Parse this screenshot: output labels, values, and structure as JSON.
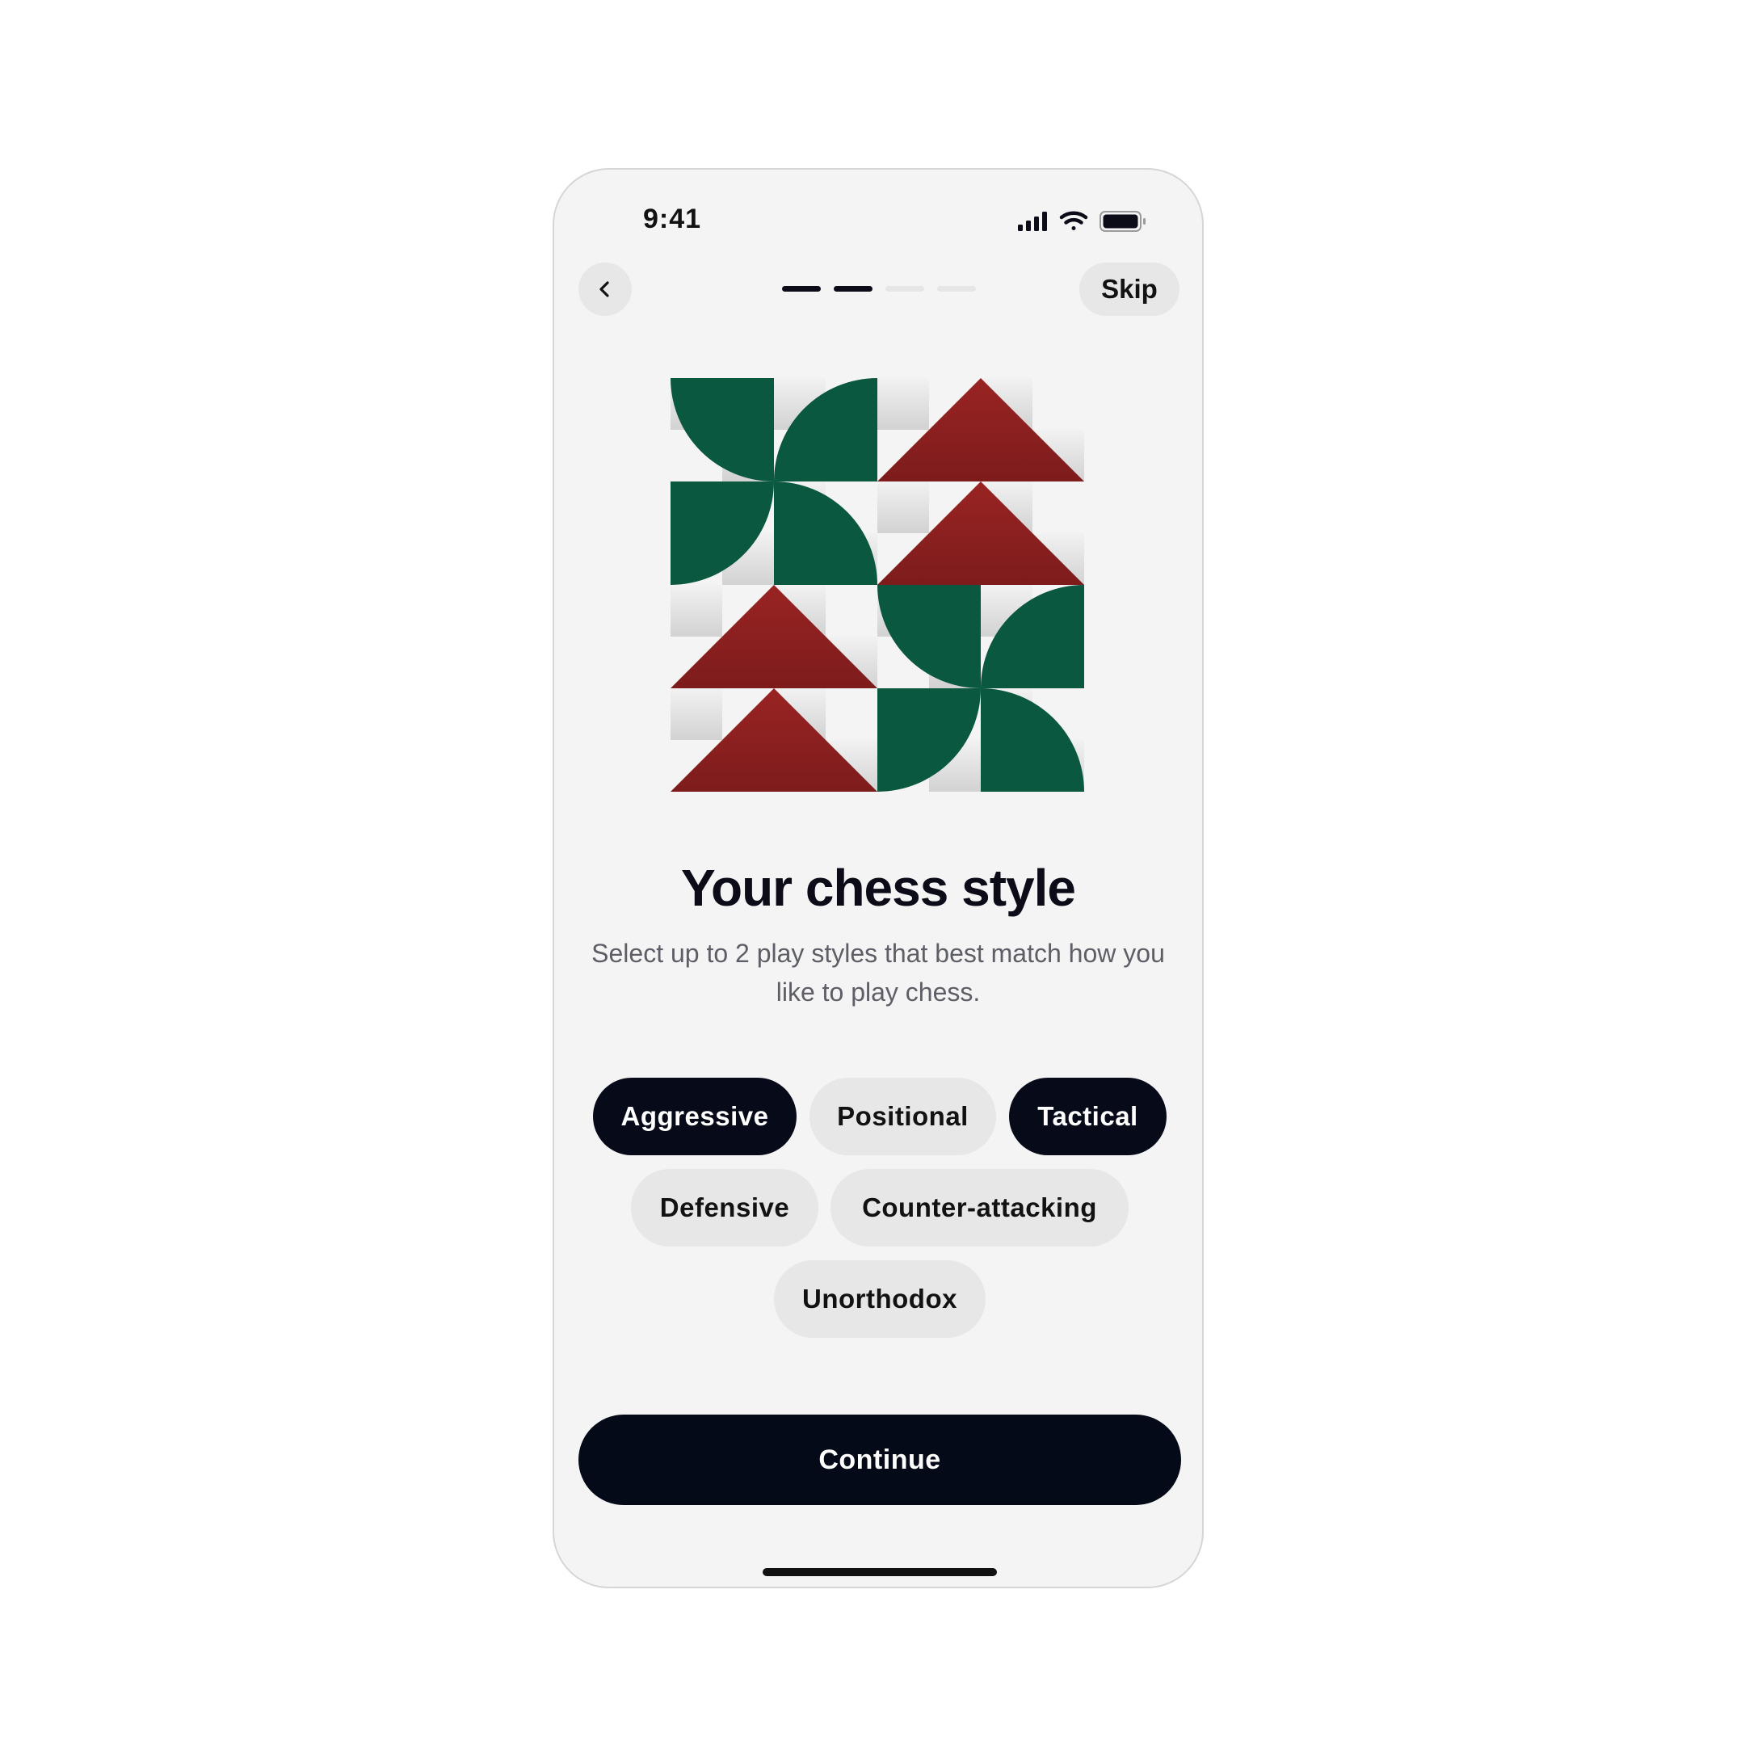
{
  "status_bar": {
    "time": "9:41",
    "icons": [
      "signal-icon",
      "wifi-icon",
      "battery-icon"
    ]
  },
  "nav": {
    "back_icon": "chevron-left-icon",
    "skip_label": "Skip",
    "progress": {
      "total_steps": 4,
      "current_step": 2
    }
  },
  "hero": {
    "colors": {
      "green": "#0b5840",
      "red": "#8a2020",
      "checker": "#dcdcdc"
    }
  },
  "content": {
    "title": "Your chess style",
    "subtitle": "Select up to 2 play styles that best match how you like to play chess."
  },
  "styles": [
    {
      "label": "Aggressive",
      "selected": true
    },
    {
      "label": "Positional",
      "selected": false
    },
    {
      "label": "Tactical",
      "selected": true
    },
    {
      "label": "Defensive",
      "selected": false
    },
    {
      "label": "Counter-attacking",
      "selected": false
    },
    {
      "label": "Unorthodox",
      "selected": false
    }
  ],
  "footer": {
    "continue_label": "Continue"
  },
  "theme": {
    "background": "#f4f4f4",
    "primary": "#050a18",
    "chip_bg": "#e7e7e7",
    "subtitle_color": "#5d5e66"
  }
}
